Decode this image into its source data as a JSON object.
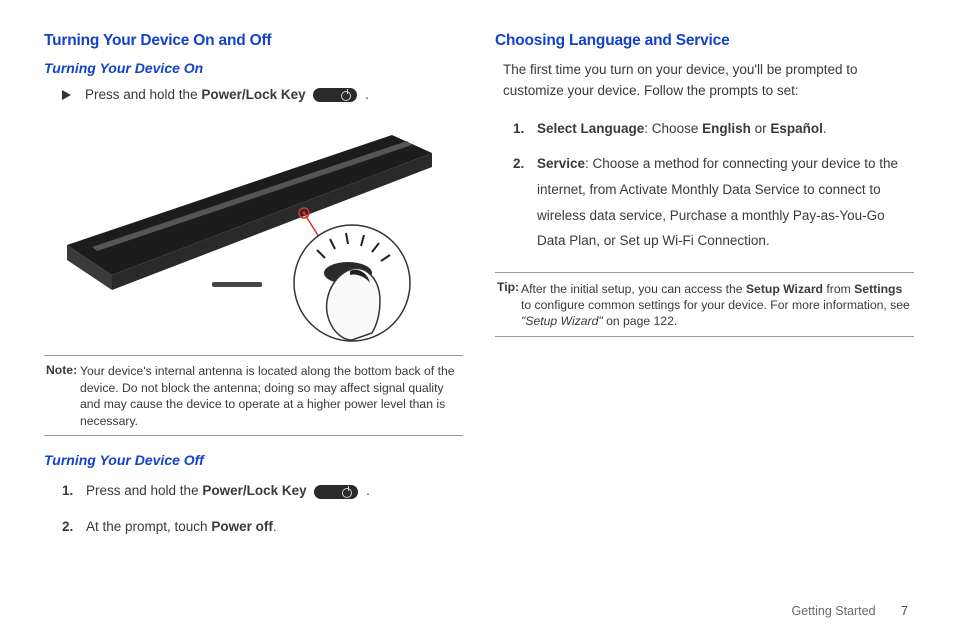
{
  "left": {
    "heading": "Turning Your Device On and Off",
    "sub_on": "Turning Your Device On",
    "on_pre": "Press and hold the ",
    "on_key": "Power/Lock Key",
    "on_post": " .",
    "note_label": "Note:",
    "note_body": "Your device's internal antenna is located along the bottom back of the device. Do not block the antenna; doing so may affect signal quality and may cause the device to operate at a higher power level than is necessary.",
    "sub_off": "Turning Your Device Off",
    "off_steps": [
      {
        "num": "1.",
        "pre": "Press and hold the ",
        "key": "Power/Lock Key",
        "post": " ."
      },
      {
        "num": "2.",
        "pre": "At the prompt, touch ",
        "key": "Power off",
        "post": "."
      }
    ]
  },
  "right": {
    "heading": "Choosing Language and Service",
    "intro": "The first time you turn on your device, you'll be prompted to customize your device. Follow the prompts to set:",
    "steps": [
      {
        "num": "1.",
        "lead": "Select Language",
        "rest": ": Choose ",
        "b1": "English",
        "mid": " or ",
        "b2": "Español",
        "end": "."
      },
      {
        "num": "2.",
        "lead": "Service",
        "rest": ": Choose a method for connecting your device to the internet, from Activate Monthly Data Service to connect to wireless data service, Purchase a monthly Pay-as-You-Go Data Plan, or Set up Wi-Fi Connection.",
        "b1": "",
        "mid": "",
        "b2": "",
        "end": ""
      }
    ],
    "tip_label": "Tip:",
    "tip_p1": "After the initial setup, you can access the ",
    "tip_b1": "Setup Wizard",
    "tip_p2": " from ",
    "tip_b2": "Settings",
    "tip_p3": " to configure common settings for your device. For more information, see ",
    "tip_ital": "\"Setup Wizard\"",
    "tip_p4": " on page 122."
  },
  "footer": {
    "section": "Getting Started",
    "page": "7"
  }
}
